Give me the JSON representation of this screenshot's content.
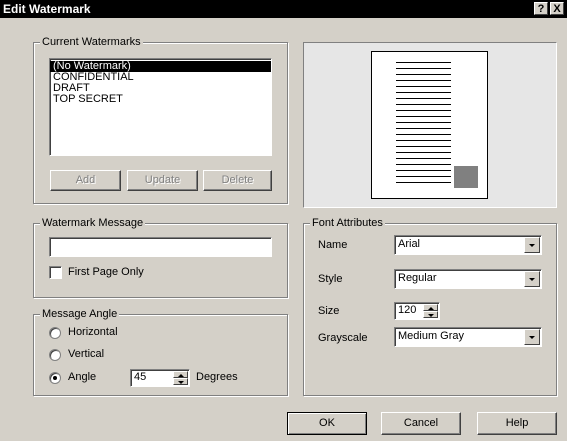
{
  "window": {
    "title": "Edit Watermark",
    "help_glyph": "?",
    "close_glyph": "X"
  },
  "current_watermarks": {
    "label": "Current Watermarks",
    "items": [
      "(No Watermark)",
      "CONFIDENTIAL",
      "DRAFT",
      "TOP SECRET"
    ],
    "selected_index": 0,
    "add_label": "Add",
    "update_label": "Update",
    "delete_label": "Delete"
  },
  "watermark_message": {
    "label": "Watermark Message",
    "value": "",
    "first_page_only_label": "First Page Only",
    "first_page_only_checked": false
  },
  "message_angle": {
    "label": "Message Angle",
    "horizontal_label": "Horizontal",
    "vertical_label": "Vertical",
    "angle_label": "Angle",
    "selected": "angle",
    "angle_value": "45",
    "degrees_label": "Degrees"
  },
  "font_attributes": {
    "label": "Font Attributes",
    "name_label": "Name",
    "name_value": "Arial",
    "style_label": "Style",
    "style_value": "Regular",
    "size_label": "Size",
    "size_value": "120",
    "grayscale_label": "Grayscale",
    "grayscale_value": "Medium Gray"
  },
  "buttons": {
    "ok_label": "OK",
    "cancel_label": "Cancel",
    "help_label": "Help"
  },
  "colors": {
    "dialog_face": "#d4d0c8",
    "titlebar": "#000000",
    "selection": "#000000",
    "preview_watermark": "#808080"
  }
}
